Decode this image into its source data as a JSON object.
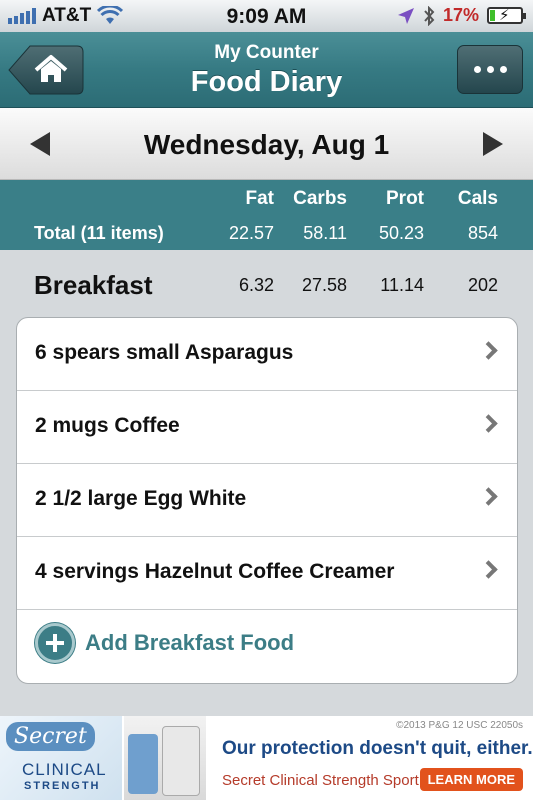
{
  "status_bar": {
    "carrier": "AT&T",
    "time": "9:09 AM",
    "battery_percent": "17%",
    "battery_level": 0.17,
    "icons": [
      "signal-icon",
      "wifi-icon",
      "location-icon",
      "bluetooth-icon",
      "battery-icon"
    ]
  },
  "nav": {
    "subtitle": "My Counter",
    "title": "Food Diary",
    "home_icon": "home-icon",
    "more_icon": "more-icon",
    "accent_color": "#3a7f88"
  },
  "date_bar": {
    "date": "Wednesday, Aug 1"
  },
  "totals": {
    "headers": {
      "fat": "Fat",
      "carbs": "Carbs",
      "prot": "Prot",
      "cals": "Cals"
    },
    "label": "Total (11 items)",
    "fat": "22.57",
    "carbs": "58.11",
    "prot": "50.23",
    "cals": "854"
  },
  "meal": {
    "name": "Breakfast",
    "fat": "6.32",
    "carbs": "27.58",
    "prot": "11.14",
    "cals": "202",
    "items": [
      {
        "label": "6 spears small Asparagus"
      },
      {
        "label": "2 mugs Coffee"
      },
      {
        "label": "2 1/2 large Egg White"
      },
      {
        "label": "4 servings Hazelnut Coffee Creamer"
      }
    ],
    "add_label": "Add Breakfast Food"
  },
  "ad": {
    "brand": "Secret",
    "clinical": "CLINICAL",
    "strength": "STRENGTH",
    "copyright": "©2013 P&G 12 USC 22050s",
    "headline": "Our protection doesn't quit, either.",
    "sub": "Secret Clinical Strength Sport",
    "cta": "LEARN MORE"
  }
}
